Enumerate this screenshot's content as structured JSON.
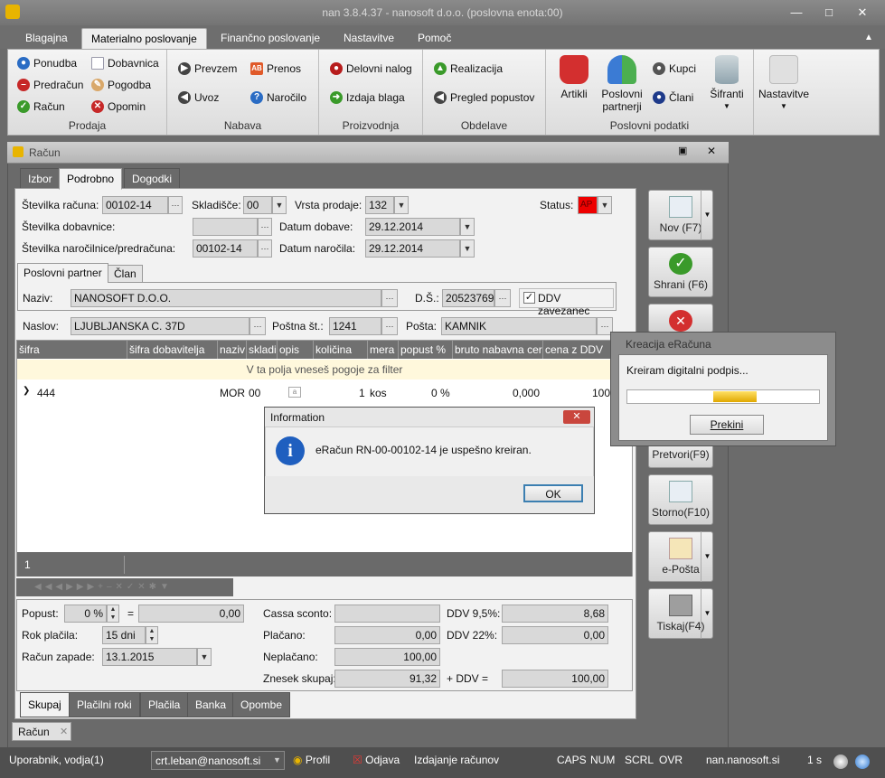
{
  "app": {
    "title": "nan 3.8.4.37 - nanosoft d.o.o. (poslovna enota:00)",
    "menu": [
      "Blagajna",
      "Materialno poslovanje",
      "Finančno poslovanje",
      "Nastavitve",
      "Pomoč"
    ]
  },
  "ribbon": {
    "prodaja": {
      "label": "Prodaja",
      "items": [
        "Ponudba",
        "Predračun",
        "Račun",
        "Dobavnica",
        "Pogodba",
        "Opomin"
      ]
    },
    "nabava": {
      "label": "Nabava",
      "items": [
        "Prevzem",
        "Uvoz",
        "Prenos",
        "Naročilo"
      ]
    },
    "proizvodnja": {
      "label": "Proizvodnja",
      "items": [
        "Delovni nalog",
        "Izdaja blaga"
      ]
    },
    "obdelave": {
      "label": "Obdelave",
      "items": [
        "Realizacija",
        "Pregled popustov"
      ]
    },
    "poslovni": {
      "label": "Poslovni podatki",
      "artikli": "Artikli",
      "partnerji": "Poslovni partnerji",
      "kupci": "Kupci",
      "clani": "Člani",
      "sifranti": "Šifranti"
    },
    "nastavitve": "Nastavitve"
  },
  "doc": {
    "title": "Račun",
    "tabs": [
      "Izbor",
      "Podrobno",
      "Dogodki"
    ],
    "fields": {
      "st_racuna_lbl": "Številka računa:",
      "st_racuna": "00102-14",
      "skladisce_lbl": "Skladišče:",
      "skladisce": "00",
      "vrsta_lbl": "Vrsta prodaje:",
      "vrsta": "132",
      "status_lbl": "Status:",
      "status": "AP",
      "st_dob_lbl": "Številka dobavnice:",
      "st_dob": "",
      "dat_dob_lbl": "Datum dobave:",
      "dat_dob": "29.12.2014",
      "st_nar_lbl": "Številka naročilnice/predračuna:",
      "st_nar": "00102-14",
      "dat_nar_lbl": "Datum naročila:",
      "dat_nar": "29.12.2014"
    },
    "partner_tabs": [
      "Poslovni partner",
      "Član"
    ],
    "partner": {
      "naziv_lbl": "Naziv:",
      "naziv": "NANOSOFT D.O.O.",
      "ds_lbl": "D.Š.:",
      "ds": "20523769",
      "ddv_lbl": "DDV zavezanec",
      "naslov_lbl": "Naslov:",
      "naslov": "LJUBLJANSKA C. 37D",
      "postna_lbl": "Poštna št.:",
      "postna": "1241",
      "posta_lbl": "Pošta:",
      "posta": "KAMNIK"
    },
    "grid": {
      "headers": [
        "šifra",
        "šifra dobavitelja",
        "naziv",
        "skladi",
        "opis",
        "količina",
        "mera",
        "popust %",
        "bruto nabavna cer",
        "cena z DDV"
      ],
      "filter": "V ta polja vneseš pogoje za filter",
      "row": {
        "sifra": "444",
        "naziv": "MOR",
        "skladi": "00",
        "kolicina": "1",
        "mera": "kos",
        "popust": "0 %",
        "bruto": "0,000",
        "cena": "100"
      },
      "count": "1"
    },
    "totals": {
      "popust_lbl": "Popust:",
      "popust_pct": "0 %",
      "popust_val": "0,00",
      "rok_lbl": "Rok plačila:",
      "rok": "15 dni",
      "zapade_lbl": "Račun zapade:",
      "zapade": "13.1.2015",
      "cassa_lbl": "Cassa sconto:",
      "cassa": "",
      "placano_lbl": "Plačano:",
      "placano": "0,00",
      "neplacano_lbl": "Neplačano:",
      "neplacano": "100,00",
      "znesek_lbl": "Znesek skupaj:",
      "znesek": "91,32",
      "ddv95_lbl": "DDV 9,5%:",
      "ddv95": "8,68",
      "ddv22_lbl": "DDV 22%:",
      "ddv22": "0,00",
      "plusddv_lbl": "+ DDV =",
      "plusddv": "100,00"
    },
    "bottom_tabs": [
      "Skupaj",
      "Plačilni roki",
      "Plačila",
      "Banka",
      "Opombe"
    ]
  },
  "side": {
    "nov": "Nov (F7)",
    "shrani": "Shrani (F6)",
    "pretvori": "Pretvori(F9)",
    "storno": "Storno(F10)",
    "eposta": "e-Pošta",
    "tiskaj": "Tiskaj(F4)"
  },
  "kreacija": {
    "title": "Kreacija eRačuna",
    "msg": "Kreiram digitalni podpis...",
    "progress": 0.35,
    "btn": "Prekini"
  },
  "info": {
    "title": "Information",
    "msg": "eRačun RN-00-00102-14 je uspešno kreiran.",
    "ok": "OK"
  },
  "doctab": "Račun",
  "status": {
    "user": "Uporabnik, vodja(1)",
    "email": "crt.leban@nanosoft.si",
    "profil": "Profil",
    "odjava": "Odjava",
    "context": "Izdajanje računov",
    "caps": "CAPS",
    "num": "NUM",
    "scrl": "SCRL",
    "ovr": "OVR",
    "host": "nan.nanosoft.si",
    "time": "1 s"
  }
}
